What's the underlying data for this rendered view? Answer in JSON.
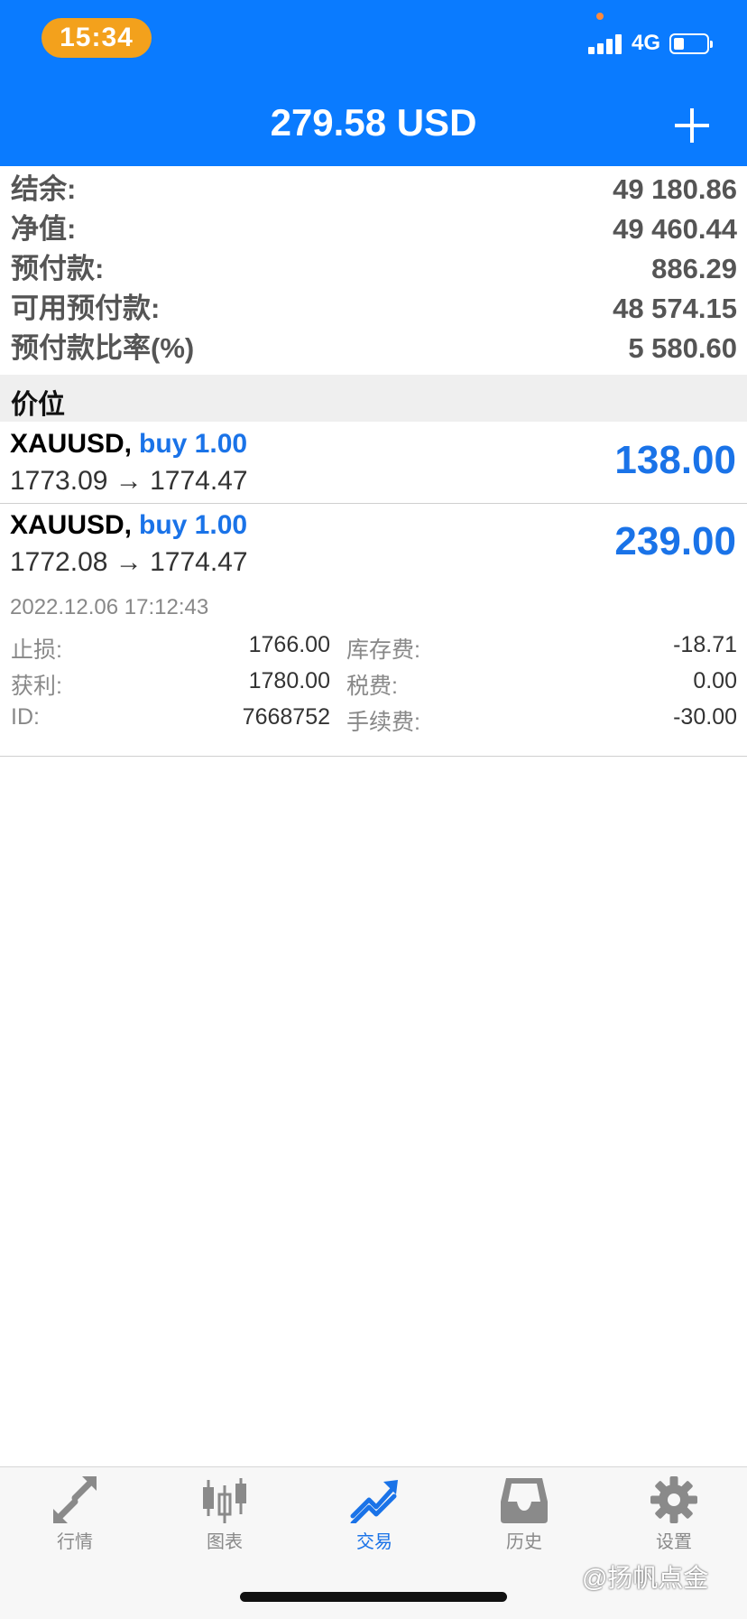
{
  "status_bar": {
    "time": "15:34",
    "network": "4G"
  },
  "header": {
    "title": "279.58 USD"
  },
  "summary": [
    {
      "label": "结余:",
      "value": "49 180.86"
    },
    {
      "label": "净值:",
      "value": "49 460.44"
    },
    {
      "label": "预付款:",
      "value": "886.29"
    },
    {
      "label": "可用预付款:",
      "value": "48 574.15"
    },
    {
      "label": "预付款比率(%)",
      "value": "5 580.60"
    }
  ],
  "positions_section": {
    "title": "价位"
  },
  "positions": [
    {
      "symbol": "XAUUSD,",
      "side": "buy 1.00",
      "prices": "1773.09 → 1774.47",
      "profit": "138.00"
    },
    {
      "symbol": "XAUUSD,",
      "side": "buy 1.00",
      "prices": "1772.08 → 1774.47",
      "profit": "239.00"
    }
  ],
  "position_detail": {
    "datetime": "2022.12.06 17:12:43",
    "rows": [
      {
        "l1": "止损:",
        "v1": "1766.00",
        "l2": "库存费:",
        "v2": "-18.71"
      },
      {
        "l1": "获利:",
        "v1": "1780.00",
        "l2": "税费:",
        "v2": "0.00"
      },
      {
        "l1": "ID:",
        "v1": "7668752",
        "l2": "手续费:",
        "v2": "-30.00"
      }
    ]
  },
  "tabs": [
    {
      "label": "行情",
      "icon": "quotes-arrows-icon"
    },
    {
      "label": "图表",
      "icon": "chart-candles-icon"
    },
    {
      "label": "交易",
      "icon": "trade-trend-icon",
      "active": true
    },
    {
      "label": "历史",
      "icon": "history-inbox-icon"
    },
    {
      "label": "设置",
      "icon": "settings-gear-icon"
    }
  ],
  "watermark": "@扬帆点金",
  "colors": {
    "header_bg": "#0a7bff",
    "accent_blue": "#1a73e8",
    "time_pill": "#f3a11c"
  }
}
